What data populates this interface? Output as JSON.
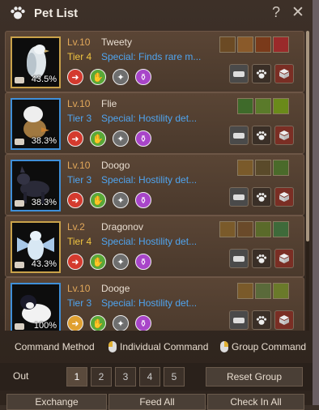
{
  "window": {
    "title": "Pet List",
    "help_label": "?",
    "close_label": "✕"
  },
  "pets": [
    {
      "level": "Lv.10",
      "name": "Tweety",
      "tier": "Tier 4",
      "special": "Special: Finds rare m...",
      "percent": "43.5%",
      "skills": [
        "skill-1",
        "skill-2",
        "skill-3",
        "skill-4"
      ]
    },
    {
      "level": "Lv.10",
      "name": "Flie",
      "tier": "Tier 3",
      "special": "Special: Hostility det...",
      "percent": "38.3%",
      "skills": [
        "skill-1",
        "skill-2",
        "skill-3"
      ]
    },
    {
      "level": "Lv.10",
      "name": "Doogo",
      "tier": "Tier 3",
      "special": "Special: Hostility det...",
      "percent": "38.3%",
      "skills": [
        "skill-1",
        "skill-2",
        "skill-3"
      ]
    },
    {
      "level": "Lv.2",
      "name": "Dragonov",
      "tier": "Tier 4",
      "special": "Special: Hostility det...",
      "percent": "43.3%",
      "skills": [
        "skill-1",
        "skill-2",
        "skill-3",
        "skill-4"
      ]
    },
    {
      "level": "Lv.10",
      "name": "Dooge",
      "tier": "Tier 3",
      "special": "Special: Hostility det...",
      "percent": "100%",
      "skills": [
        "skill-1",
        "skill-2",
        "skill-3"
      ]
    }
  ],
  "command": {
    "label": "Command Method",
    "individual": "Individual Command",
    "group": "Group Command"
  },
  "out": {
    "label": "Out",
    "slots": [
      "1",
      "2",
      "3",
      "4",
      "5"
    ],
    "reset": "Reset Group"
  },
  "bottom": {
    "exchange": "Exchange",
    "feed_all": "Feed All",
    "check_in_all": "Check In All"
  },
  "colors": {
    "tier4": "#f0c440",
    "tier3": "#4fa4ef",
    "special": "#4fa4ef",
    "level": "#e2a85a"
  }
}
